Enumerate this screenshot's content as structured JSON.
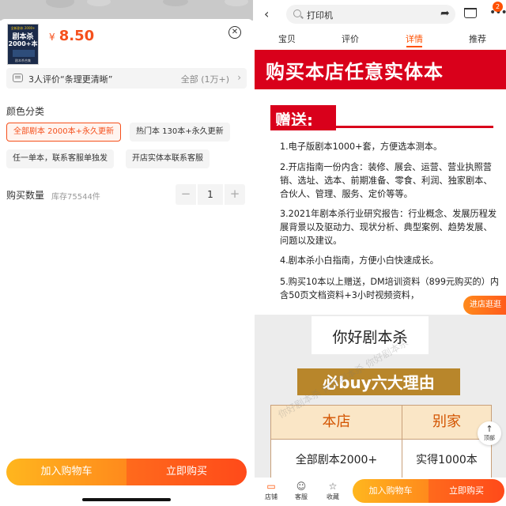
{
  "left": {
    "product_thumb": {
      "top_line": "全新剧本 2000+",
      "line1": "剧本杀",
      "line2": "2000+本",
      "bottom_line": "剧本杀合集"
    },
    "price_symbol": "¥",
    "price": "8.50",
    "review_summary": "3人评价“条理更清晰”",
    "review_all": "全部 (1万+)",
    "color_section_title": "颜色分类",
    "options": [
      {
        "label": "全部剧本 2000本+永久更新",
        "selected": true
      },
      {
        "label": "热门本 130本+永久更新",
        "selected": false
      },
      {
        "label": "任一单本，联系客服单独发",
        "selected": false
      },
      {
        "label": "开店实体本联系客服",
        "selected": false
      }
    ],
    "quantity_label": "购买数量",
    "stock": "库存75544件",
    "quantity_value": "1",
    "minus": "−",
    "plus": "+",
    "add_to_cart": "加入购物车",
    "buy_now": "立即购买"
  },
  "right": {
    "search_text": "打印机",
    "cart_badge": "2",
    "tabs": [
      "宝贝",
      "评价",
      "详情",
      "推荐"
    ],
    "active_tab": "详情",
    "banner_title": "购买本店任意实体本",
    "gift_title": "赠送:",
    "gift_items": [
      "1.电子版剧本1000+套，方便选本测本。",
      "2.开店指南一份内含：装修、展会、运营、营业执照营销、选址、选本、前期准备、零食、利润、独家剧本、合伙人、管理、服务、定价等等。",
      "3.2021年剧本杀行业研究报告：行业概念、发展历程发展背景以及驱动力、现状分析、典型案例、趋势发展、问题以及建议。",
      "4.剧本杀小白指南，方便小白快速成长。",
      "5.购买10本以上赠送，DM培训资料（899元购买的）内含50页文档资料+3小时视频资料，"
    ],
    "side_tag": "进店逛逛",
    "hello_text": "你好剧本杀",
    "buy_reasons": "必buy六大理由",
    "table": {
      "headers": [
        "本店",
        "别家"
      ],
      "row": [
        "全部剧本2000+",
        "实得1000本"
      ]
    },
    "top_button": "顶部",
    "watermark": "你好剧本杀 你好剧本杀 你好剧本杀",
    "bottom_nav": [
      {
        "label": "店铺",
        "icon": "store-icon"
      },
      {
        "label": "客服",
        "icon": "chat-icon"
      },
      {
        "label": "收藏",
        "icon": "star-icon"
      }
    ],
    "add_to_cart": "加入购物车",
    "buy_now": "立即购买"
  },
  "colors": {
    "accent": "#ff5000",
    "price": "#f5501c",
    "banner_red": "#d9001b",
    "gold": "#b8862b"
  }
}
